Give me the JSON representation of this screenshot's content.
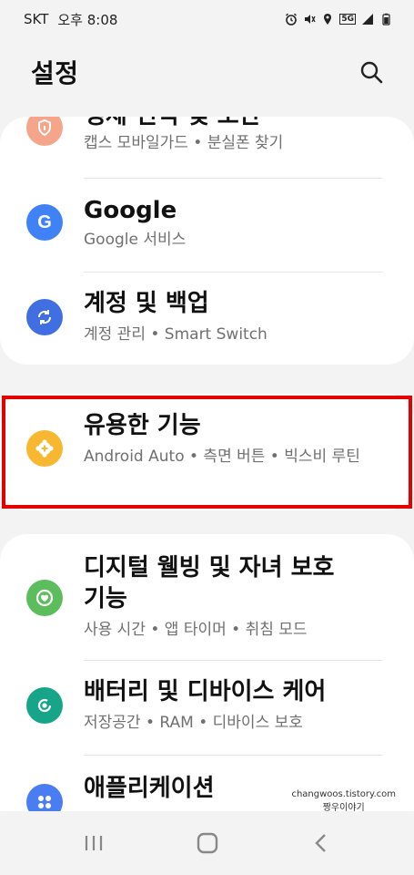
{
  "status": {
    "carrier": "SKT",
    "time": "오후 8:08",
    "network": "5G"
  },
  "header": {
    "title": "설정"
  },
  "items": [
    {
      "title": "생체 인식 및 보안",
      "subtitle": "캡스 모바일가드 • 분실폰 찾기",
      "icon": "shield-icon",
      "color": "#f4a58a"
    },
    {
      "title": "Google",
      "subtitle": "Google 서비스",
      "icon": "google-icon",
      "color": "#3f82f5"
    },
    {
      "title": "계정 및 백업",
      "subtitle": "계정 관리 • Smart Switch",
      "icon": "sync-icon",
      "color": "#3f6fe0"
    },
    {
      "title": "유용한 기능",
      "subtitle": "Android Auto • 측면 버튼 • 빅스비 루틴",
      "icon": "plus-gear-icon",
      "color": "#f7b731"
    },
    {
      "title": "디지털 웰빙 및 자녀 보호 기능",
      "subtitle": "사용 시간 • 앱 타이머 • 취침 모드",
      "icon": "wellbeing-icon",
      "color": "#5cbd5c"
    },
    {
      "title": "배터리 및 디바이스 케어",
      "subtitle": "저장공간 • RAM • 디바이스 보호",
      "icon": "device-care-icon",
      "color": "#17a58a"
    },
    {
      "title": "애플리케이션",
      "subtitle": "",
      "icon": "apps-icon",
      "color": "#4a7cf2"
    }
  ],
  "watermark": {
    "line1": "changwoos.tistory.com",
    "line2": "짱우이야기"
  }
}
